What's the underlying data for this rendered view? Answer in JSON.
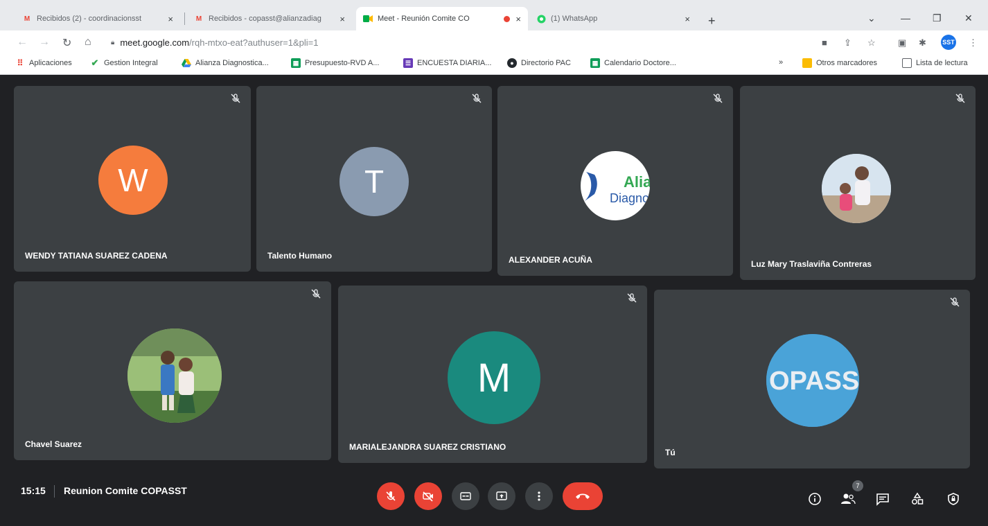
{
  "browser": {
    "tabs": [
      {
        "title": "Recibidos (2) - coordinacionsst",
        "icon": "gmail-icon",
        "active": false
      },
      {
        "title": "Recibidos - copasst@alianzadiag",
        "icon": "gmail-icon",
        "active": false
      },
      {
        "title": "Meet - Reunión Comite CO",
        "icon": "meet-icon",
        "active": true,
        "recording": true
      },
      {
        "title": "(1) WhatsApp",
        "icon": "whatsapp-icon",
        "active": false
      }
    ],
    "close_glyph": "×",
    "new_tab_glyph": "+",
    "url": {
      "host": "meet.google.com",
      "path": "/rqh-mtxo-eat?authuser=1&pli=1"
    },
    "profile_initials": "SST",
    "bookmarks": [
      {
        "label": "Aplicaciones",
        "icon": "apps-grid-icon",
        "color": "#ea4335"
      },
      {
        "label": "Gestion Integral",
        "icon": "checkmark-icon",
        "color": "#34a853"
      },
      {
        "label": "Alianza Diagnostica...",
        "icon": "drive-icon",
        "color": "#fbbc04"
      },
      {
        "label": "Presupuesto-RVD A...",
        "icon": "sheets-icon",
        "color": "#0f9d58"
      },
      {
        "label": "ENCUESTA DIARIA...",
        "icon": "forms-icon",
        "color": "#673ab7"
      },
      {
        "label": "Directorio PAC",
        "icon": "github-icon",
        "color": "#24292e"
      },
      {
        "label": "Calendario Doctore...",
        "icon": "sheets-icon",
        "color": "#0f9d58"
      }
    ],
    "bookmarks_more": "»",
    "other_bookmarks": "Otros marcadores",
    "reading_list": "Lista de lectura"
  },
  "meet": {
    "participants": [
      {
        "name": "WENDY TATIANA SUAREZ CADENA",
        "avatar_initial": "W",
        "avatar_color": "#f57c3d",
        "muted": true
      },
      {
        "name": "Talento Humano",
        "avatar_initial": "T",
        "avatar_color": "#8a9bb0",
        "muted": true
      },
      {
        "name": "ALEXANDER ACUÑA",
        "avatar_initial": "",
        "avatar_text": "Alia Diagno",
        "avatar_type": "logo",
        "muted": true
      },
      {
        "name": "Luz Mary Traslaviña Contreras",
        "avatar_initial": "",
        "avatar_type": "photo",
        "muted": true
      },
      {
        "name": "Chavel Suarez",
        "avatar_initial": "",
        "avatar_type": "photo",
        "muted": true
      },
      {
        "name": "MARIALEJANDRA SUAREZ CRISTIANO",
        "avatar_initial": "M",
        "avatar_color": "#1a8a7e",
        "muted": true
      },
      {
        "name": "Tú",
        "avatar_initial": "",
        "avatar_text": "OPASS",
        "avatar_type": "logo",
        "muted": true
      }
    ],
    "time": "15:15",
    "meeting_title": "Reunion Comite COPASST",
    "participant_count": "7",
    "colors": {
      "red": "#ea4335",
      "stage": "#202124",
      "tile": "#3c4043"
    }
  }
}
